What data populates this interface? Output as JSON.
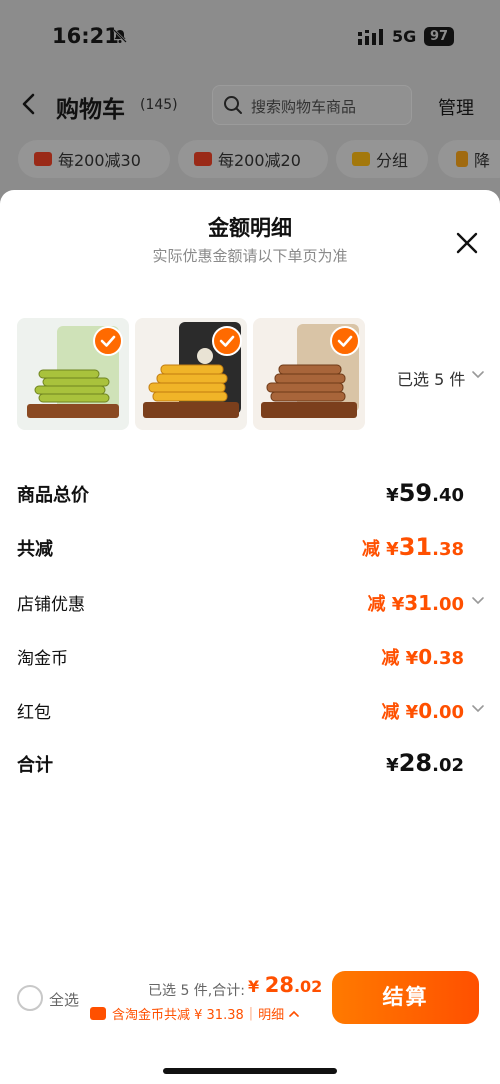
{
  "status_bar": {
    "time": "16:21",
    "network": "5G",
    "battery": "97"
  },
  "header": {
    "title": "购物车",
    "count": "(145)",
    "search_placeholder": "搜索购物车商品",
    "manage": "管理"
  },
  "chips": [
    "每200减30",
    "每200减20",
    "分组",
    "降"
  ],
  "sheet": {
    "title": "金额明细",
    "subtitle": "实际优惠金额请以下单页为准",
    "selected_summary": "已选 5 件"
  },
  "rows": [
    {
      "label": "商品总价",
      "prefix": "¥",
      "int": "59",
      "dec": ".40",
      "bold": true,
      "orange": false
    },
    {
      "label": "共减",
      "prefix": "减 ¥",
      "int": "31",
      "dec": ".38",
      "bold": true,
      "orange": true
    },
    {
      "label": "店铺优惠",
      "prefix": "减 ¥",
      "int": "31",
      "dec": ".00",
      "bold": false,
      "orange": true
    },
    {
      "label": "淘金币",
      "prefix": "减 ¥",
      "int": "0",
      "dec": ".38",
      "bold": false,
      "orange": true
    },
    {
      "label": "红包",
      "prefix": "减 ¥",
      "int": "0",
      "dec": ".00",
      "bold": false,
      "orange": true
    },
    {
      "label": "合计",
      "prefix": "¥",
      "int": "28",
      "dec": ".02",
      "bold": true,
      "orange": false
    }
  ],
  "footer": {
    "select_all": "全选",
    "selected_text": "已选 5 件,合计:",
    "total_prefix": "¥ ",
    "total_int": "28",
    "total_dec": ".02",
    "coin_text": "含淘金币共减 ¥ 31.38",
    "detail": "明细",
    "checkout": "结算"
  },
  "colors": {
    "accent": "#ff5000",
    "dim_overlay": "#8c8c8c"
  }
}
